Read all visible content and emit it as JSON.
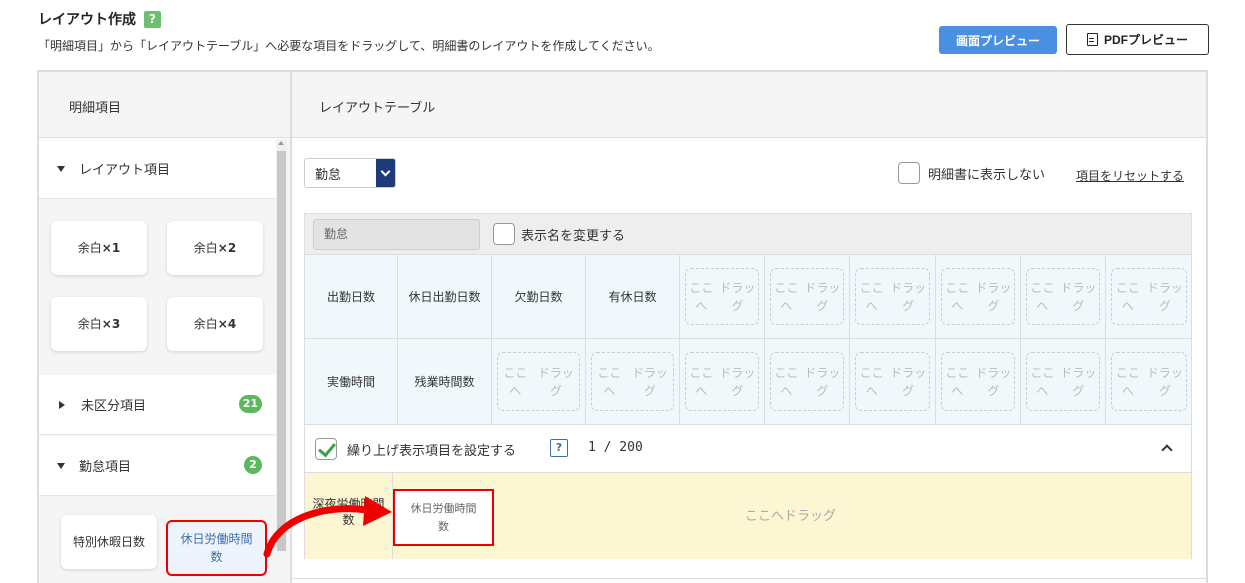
{
  "header": {
    "title": "レイアウト作成",
    "help_glyph": "?",
    "description": "「明細項目」から「レイアウトテーブル」へ必要な項目をドラッグして、明細書のレイアウトを作成してください。",
    "screen_preview_label": "画面プレビュー",
    "pdf_preview_label": "PDFプレビュー"
  },
  "panels": {
    "left_title": "明細項目",
    "right_title": "レイアウトテーブル"
  },
  "sidebar": {
    "layout_section": {
      "label": "レイアウト項目",
      "expanded": true,
      "tiles": [
        {
          "label": "余白",
          "mult": "×1"
        },
        {
          "label": "余白",
          "mult": "×2"
        },
        {
          "label": "余白",
          "mult": "×3"
        },
        {
          "label": "余白",
          "mult": "×4"
        }
      ]
    },
    "unclassified_section": {
      "label": "未区分項目",
      "count": "21",
      "expanded": false
    },
    "attendance_section": {
      "label": "勤怠項目",
      "count": "2",
      "expanded": true,
      "tiles": [
        {
          "label": "特別休暇日数"
        },
        {
          "label": "休日労働時間数",
          "line1": "休日労働時間",
          "line2": "数",
          "selected": true
        }
      ]
    }
  },
  "table_controls": {
    "select_value": "勤怠",
    "hide_label": "明細書に表示しない",
    "reset_label": "項目をリセットする"
  },
  "table": {
    "name_value": "勤怠",
    "rename_label": "表示名を変更する",
    "drop_line1": "ここへ",
    "drop_line2": "ドラッグ",
    "row1": [
      "出勤日数",
      "休日出勤日数",
      "欠勤日数",
      "有休日数"
    ],
    "row2": [
      "実働時間",
      "残業時間数"
    ]
  },
  "carryover": {
    "label": "繰り上げ表示項目を設定する",
    "help_glyph": "?",
    "count": "1 / 200",
    "first_cell_line1": "深夜労働時間",
    "first_cell_line2": "数",
    "chip_line1": "休日労働時間",
    "chip_line2": "数",
    "drop_label": "ここへドラッグ"
  },
  "colors": {
    "accent_blue": "#4a90e2",
    "badge_green": "#5cb85c",
    "highlight_red": "#e00000",
    "drop_zone_yellow": "#fdf6d2"
  }
}
